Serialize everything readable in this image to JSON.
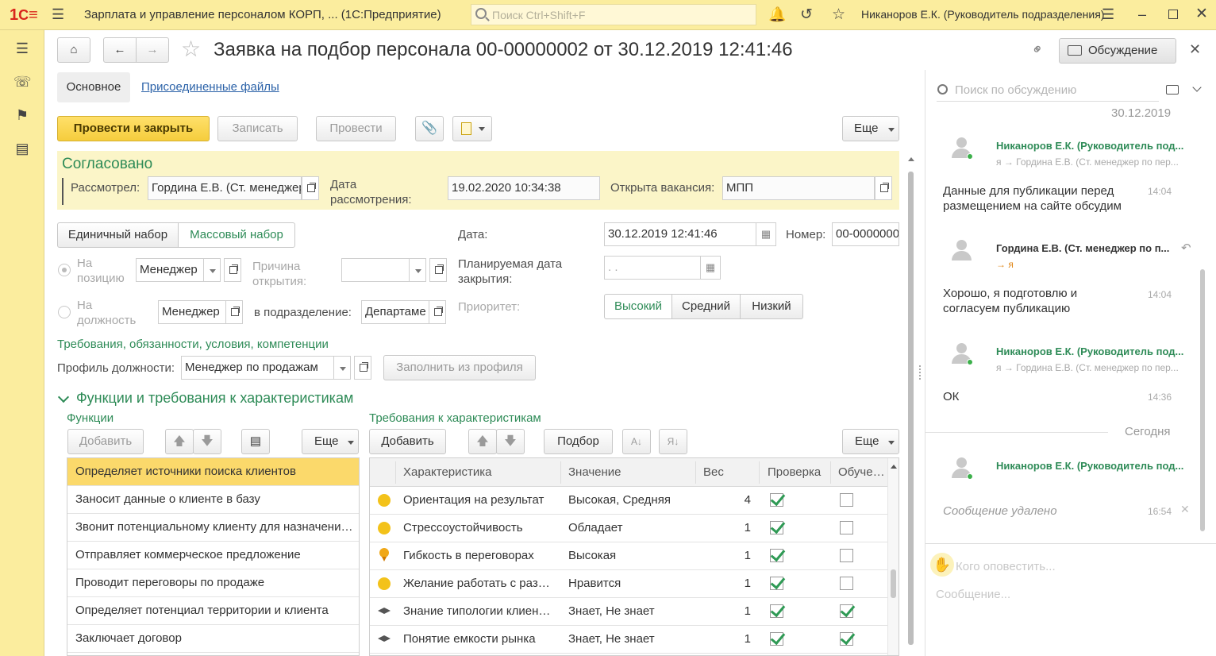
{
  "titlebar": {
    "app_title": "Зарплата и управление персоналом КОРП, ... (1С:Предприятие)",
    "search_placeholder": "Поиск Ctrl+Shift+F",
    "user": "Никаноров Е.К. (Руководитель подразделения)"
  },
  "document": {
    "title": "Заявка на подбор персонала 00-00000002 от 30.12.2019 12:41:46",
    "discussion_button": "Обсуждение",
    "tabs": [
      "Основное",
      "Присоединенные файлы"
    ]
  },
  "toolbar": {
    "post_close": "Провести и закрыть",
    "save": "Записать",
    "post": "Провести",
    "more": "Еще"
  },
  "approval": {
    "status": "Согласовано",
    "reviewer_label": "Рассмотрел:",
    "reviewer_value": "Гордина Е.В. (Ст. менеджер",
    "review_date_label_1": "Дата",
    "review_date_label_2": "рассмотрения:",
    "review_date_value": "19.02.2020 10:34:38",
    "vacancy_label": "Открыта вакансия:",
    "vacancy_value": "МПП"
  },
  "form": {
    "mode_single": "Единичный набор",
    "mode_mass": "Массовый набор",
    "date_label": "Дата:",
    "date_value": "30.12.2019 12:41:46",
    "number_label": "Номер:",
    "number_value": "00-0000000",
    "position_label_1": "На",
    "position_label_2": "позицию",
    "position_value": "Менеджер",
    "reason_label_1": "Причина",
    "reason_label_2": "открытия:",
    "planned_close_label_1": "Планируемая дата",
    "planned_close_label_2": "закрытия:",
    "planned_close_value": " .  .",
    "job_label_1": "На",
    "job_label_2": "должность",
    "job_value": "Менеджер",
    "dept_label": "в подразделение:",
    "dept_value": "Департаме",
    "priority_label": "Приоритет:",
    "priority_options": [
      "Высокий",
      "Средний",
      "Низкий"
    ],
    "requirements_link": "Требования, обязанности, условия, компетенции",
    "profile_label": "Профиль должности:",
    "profile_value": "Менеджер  по продажам",
    "fill_from_profile": "Заполнить из профиля"
  },
  "functions_section": {
    "header": "Функции и требования к характеристикам",
    "functions_title": "Функции",
    "add": "Добавить",
    "more": "Еще",
    "items": [
      "Определяет источники поиска клиентов",
      "Заносит данные о клиенте в базу",
      "Звонит потенциальному клиенту для назначения встречи",
      "Отправляет коммерческое предложение",
      "Проводит переговоры по продаже",
      "Определяет потенциал территории и клиента",
      "Заключает договор"
    ]
  },
  "requirements": {
    "title": "Требования к характеристикам",
    "add": "Добавить",
    "pick": "Подбор",
    "more": "Еще",
    "columns": [
      "Характеристика",
      "Значение",
      "Вес",
      "Проверка",
      "Обучение"
    ],
    "rows": [
      {
        "icon": "smile-icon",
        "name": "Ориентация на результат",
        "value": "Высокая, Средняя",
        "weight": "4",
        "check": true,
        "training": false
      },
      {
        "icon": "smile-icon",
        "name": "Стрессоустойчивость",
        "value": "Обладает",
        "weight": "1",
        "check": true,
        "training": false
      },
      {
        "icon": "medal-icon",
        "name": "Гибкость в переговорах",
        "value": "Высокая",
        "weight": "1",
        "check": true,
        "training": false
      },
      {
        "icon": "smile-icon",
        "name": "Желание работать с разными людьми",
        "value": "Нравится",
        "weight": "1",
        "check": true,
        "training": false
      },
      {
        "icon": "cap-icon",
        "name": "Знание типологии клиентов",
        "value": "Знает, Не знает",
        "weight": "1",
        "check": true,
        "training": true
      },
      {
        "icon": "cap-icon",
        "name": "Понятие емкости рынка",
        "value": "Знает, Не знает",
        "weight": "1",
        "check": true,
        "training": true
      }
    ]
  },
  "discussion": {
    "search_placeholder": "Поиск по обсуждению",
    "date_top": "30.12.2019",
    "date_today": "Сегодня",
    "messages": [
      {
        "author": "Никаноров Е.К. (Руководитель под...",
        "route": "я → Гордина Е.В. (Ст. менеджер по пер...",
        "text": "Данные для публикации перед размещением на сайте обсудим",
        "time": "14:04"
      },
      {
        "author": "Гордина Е.В. (Ст. менеджер по п...",
        "route": "→ я",
        "text": "Хорошо, я подготовлю и согласуем публикацию",
        "time": "14:04"
      },
      {
        "author": "Никаноров Е.К. (Руководитель под...",
        "route": "я → Гордина Е.В. (Ст. менеджер по пер...",
        "text": "ОК",
        "time": "14:36"
      },
      {
        "author": "Никаноров Е.К. (Руководитель под...",
        "route": "",
        "text": "Сообщение удалено",
        "time": "16:54"
      }
    ],
    "notify_placeholder": "Кого оповестить...",
    "message_placeholder": "Сообщение..."
  },
  "colors": {
    "accent_yellow": "#fbed9e",
    "green": "#2e8b57",
    "selected_row": "#fbd96b"
  }
}
